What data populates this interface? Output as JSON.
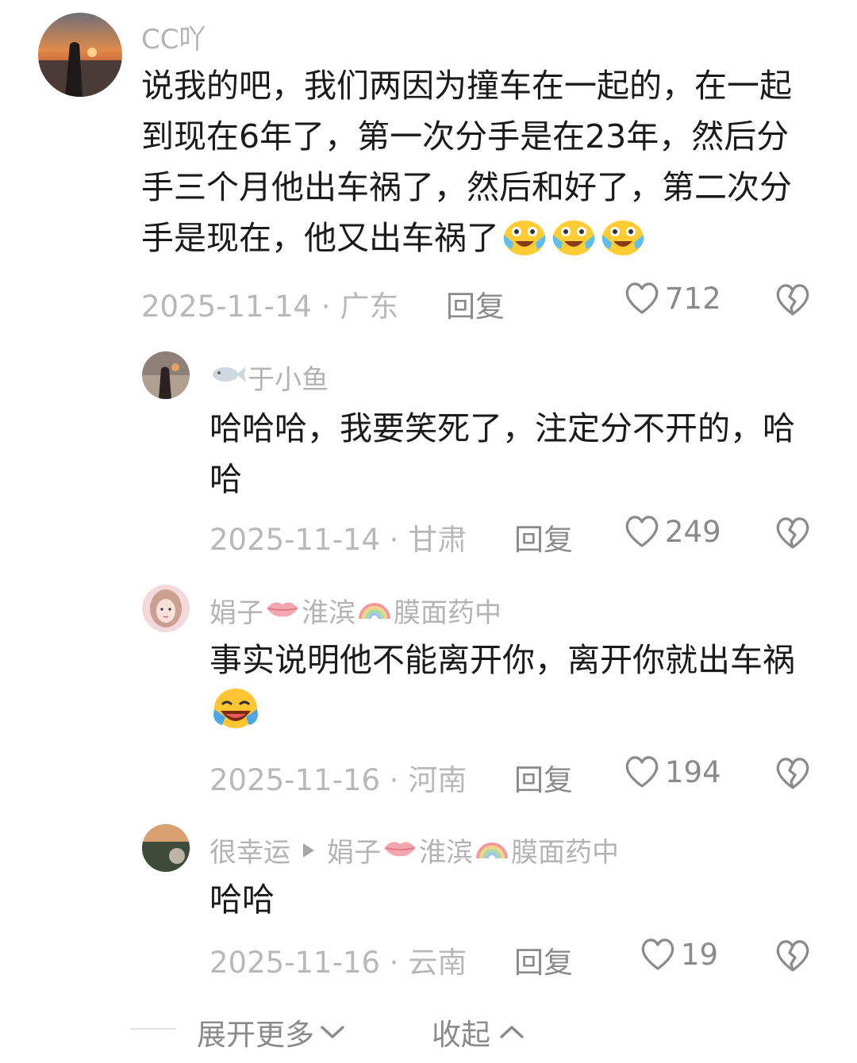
{
  "comments": [
    {
      "username": "CC吖",
      "text": "说我的吧，我们两因为撞车在一起的，在一起到现在6年了，第一次分手是在23年，然后分手三个月他出车祸了，然后和好了，第二次分手是现在，他又出车祸了",
      "emojis": [
        "crying-laughing-emoji",
        "crying-laughing-emoji",
        "crying-laughing-emoji"
      ],
      "date": "2025-11-14",
      "location": "广东",
      "reply_label": "回复",
      "likes": "712"
    },
    {
      "username": "于小鱼",
      "username_icon": "fish-icon",
      "text": "哈哈哈，我要笑死了，注定分不开的，哈哈",
      "date": "2025-11-14",
      "location": "甘肃",
      "reply_label": "回复",
      "likes": "249"
    },
    {
      "username_parts": [
        "娟子",
        "淮滨",
        "膜面药中"
      ],
      "username_icons": [
        "lips-icon",
        "rainbow-icon"
      ],
      "text": "事实说明他不能离开你，离开你就出车祸",
      "emojis": [
        "laughing-crying-emoji"
      ],
      "date": "2025-11-16",
      "location": "河南",
      "reply_label": "回复",
      "likes": "194"
    },
    {
      "username": "很幸运",
      "reply_to_parts": [
        "娟子",
        "淮滨",
        "膜面药中"
      ],
      "text": "哈哈",
      "date": "2025-11-16",
      "location": "云南",
      "reply_label": "回复",
      "likes": "19"
    }
  ],
  "separator": " · ",
  "footer": {
    "expand_label": "展开更多",
    "collapse_label": "收起"
  }
}
